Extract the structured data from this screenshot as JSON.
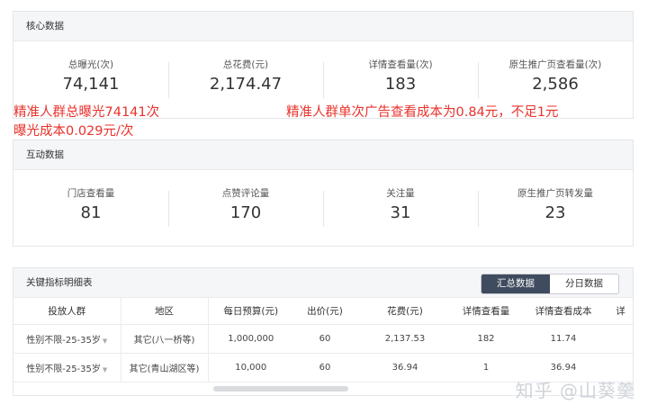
{
  "core": {
    "title": "核心数据",
    "metrics": [
      {
        "label": "总曝光(次)",
        "value": "74,141"
      },
      {
        "label": "总花费(元)",
        "value": "2,174.47"
      },
      {
        "label": "详情查看量(次)",
        "value": "183"
      },
      {
        "label": "原生推广页查看量(次)",
        "value": "2,586"
      }
    ]
  },
  "annotations": {
    "left_line1": "精准人群总曝光74141次",
    "left_line2": "曝光成本0.029元/次",
    "right": "精准人群单次广告查看成本为0.84元，不足1元"
  },
  "interaction": {
    "title": "互动数据",
    "metrics": [
      {
        "label": "门店查看量",
        "value": "81"
      },
      {
        "label": "点赞评论量",
        "value": "170"
      },
      {
        "label": "关注量",
        "value": "31"
      },
      {
        "label": "原生推广页转发量",
        "value": "23"
      }
    ]
  },
  "detail": {
    "title": "关键指标明细表",
    "tabs": [
      {
        "label": "汇总数据",
        "active": true
      },
      {
        "label": "分日数据",
        "active": false
      }
    ],
    "columns": [
      "投放人群",
      "地区",
      "每日预算(元)",
      "出价(元)",
      "花费(元)",
      "详情查看量",
      "详情查看成本",
      "详"
    ],
    "rows": [
      [
        "性别不限-25-35岁",
        "其它(八一桥等)",
        "1,000,000",
        "60",
        "2,137.53",
        "182",
        "11.74",
        ""
      ],
      [
        "性别不限-25-35岁",
        "其它(青山湖区等)",
        "10,000",
        "60",
        "36.94",
        "1",
        "36.94",
        ""
      ]
    ]
  },
  "watermark": "知乎 @山葵羹"
}
